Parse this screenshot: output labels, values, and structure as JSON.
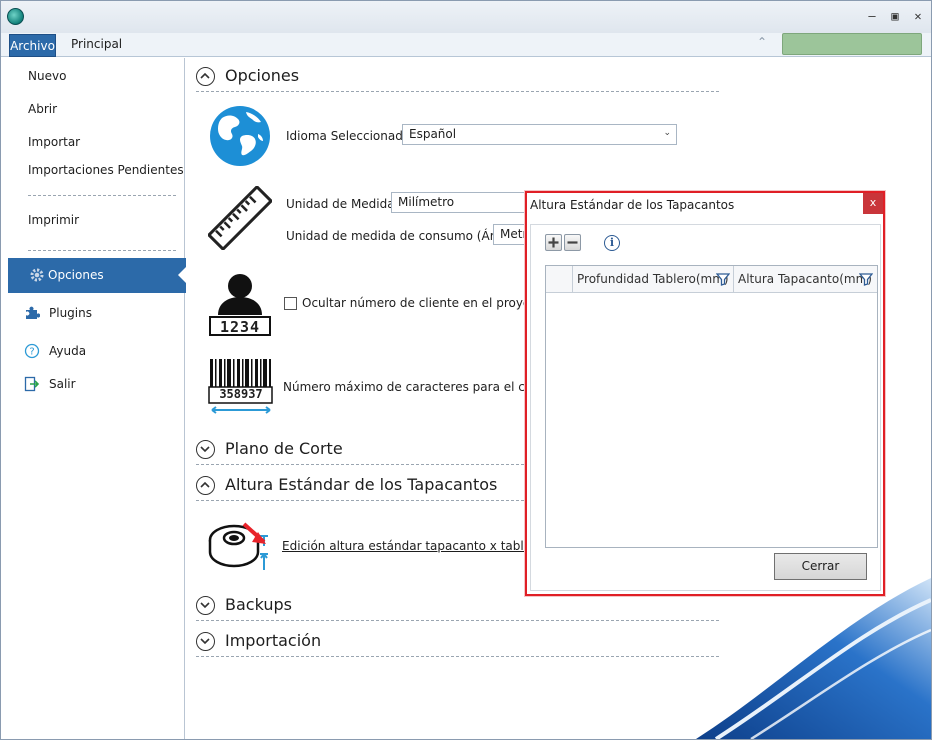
{
  "ribbon": {
    "tab_archivo": "Archivo",
    "tab_principal": "Principal"
  },
  "sidebar": {
    "items": [
      {
        "label": "Nuevo"
      },
      {
        "label": "Abrir"
      },
      {
        "label": "Importar"
      },
      {
        "label": "Importaciones Pendientes"
      },
      {
        "label": "Imprimir"
      },
      {
        "label": "Opciones"
      },
      {
        "label": "Plugins"
      },
      {
        "label": "Ayuda"
      },
      {
        "label": "Salir"
      }
    ]
  },
  "main": {
    "sections": {
      "opciones": "Opciones",
      "plano_corte": "Plano de Corte",
      "altura": "Altura Estándar de los Tapacantos",
      "backups": "Backups",
      "importacion": "Importación"
    },
    "idioma_label": "Idioma Seleccionado:",
    "idioma_value": "Español",
    "unidad_label": "Unidad de Medida:",
    "unidad_value": "Milímetro",
    "unidad_consumo_label": "Unidad de medida de consumo (Área):",
    "unidad_consumo_value": "Metr",
    "ocultar_label": "Ocultar número de cliente en el proyecto",
    "max_caracteres_label": "Número máximo de caracteres para el código",
    "edicion_link": "Edición altura estándar tapacanto x tablero",
    "client_number": "1234",
    "barcode_number": "358937"
  },
  "dialog": {
    "title": "Altura Estándar de los Tapacantos",
    "close": "x",
    "info": "i",
    "columns": [
      "Profundidad Tablero(mm)",
      "Altura Tapacanto(mm)"
    ],
    "cerrar": "Cerrar"
  },
  "colors": {
    "accent": "#2c6aa9",
    "dialog_border": "#e01f26",
    "annotation_arrow": "#e8232a"
  }
}
